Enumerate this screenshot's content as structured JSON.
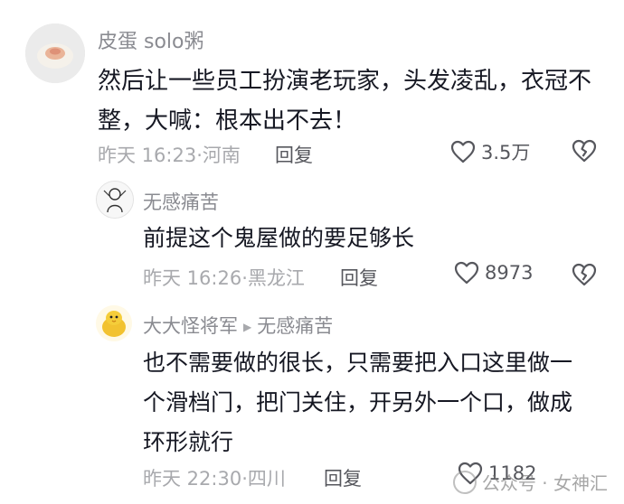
{
  "comments": [
    {
      "username": "皮蛋 solo粥",
      "lines": [
        "然后让一些员工扮演老玩家，头发凌乱，衣冠不",
        "整，大喊：根本出不去！"
      ],
      "time": "昨天 16:23",
      "location": "河南",
      "reply_label": "回复",
      "likes": "3.5万"
    },
    {
      "username": "无感痛苦",
      "lines": [
        "前提这个鬼屋做的要足够长"
      ],
      "time": "昨天 16:26",
      "location": "黑龙江",
      "reply_label": "回复",
      "likes": "8973"
    },
    {
      "username": "大大怪将军",
      "reply_to": "无感痛苦",
      "lines": [
        "也不需要做的很长，只需要把入口这里做一",
        "个滑档门，把门关住，开另外一个口，做成",
        "环形就行"
      ],
      "time": "昨天 22:30",
      "location": "四川",
      "reply_label": "回复",
      "likes": "1182"
    }
  ],
  "separator": "·",
  "watermark": "公众号 · 女神汇",
  "colors": {
    "text": "#161823",
    "secondary": "#8a8b91",
    "meta": "#a8a9ad"
  },
  "icons": [
    "heart-outline-icon",
    "broken-heart-icon",
    "reply-arrow-icon"
  ]
}
